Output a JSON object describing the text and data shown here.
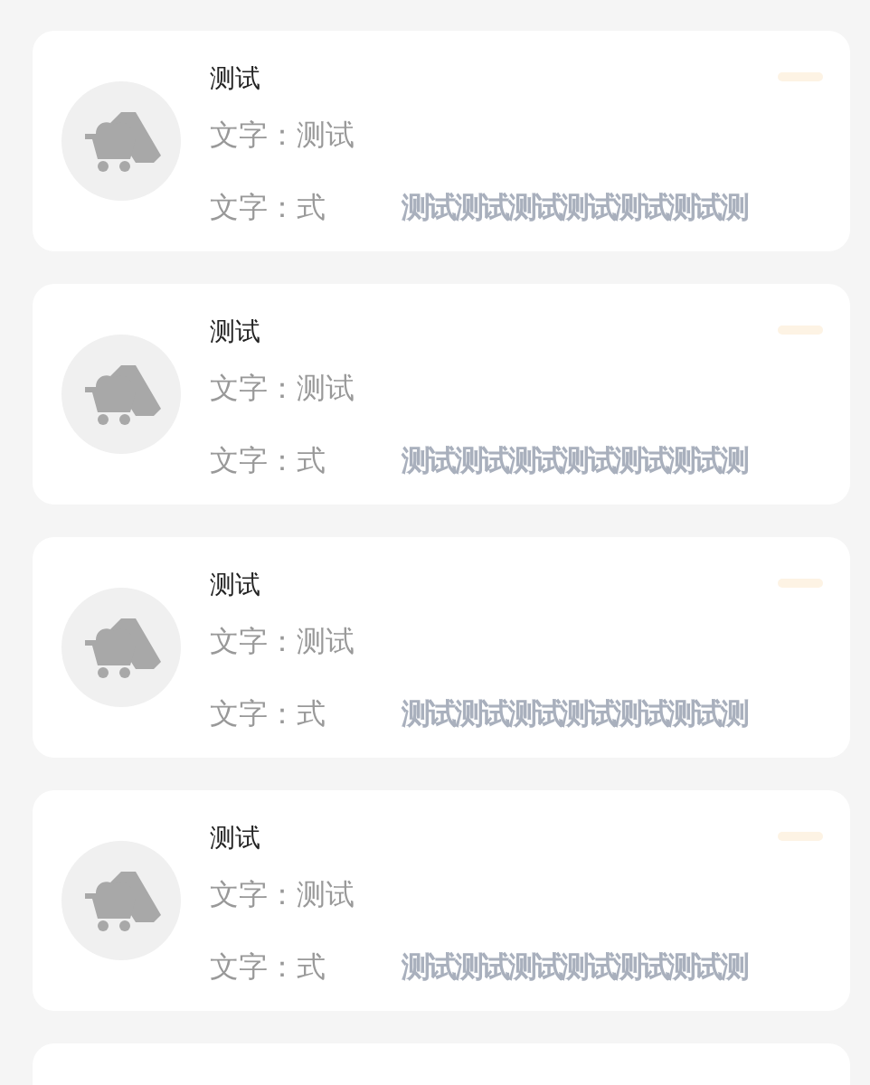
{
  "cards": [
    {
      "title": "测试",
      "line_1": "文字：测试",
      "line_2": "文字：式",
      "line_2_extra": "测试测试测试测试测试测试测"
    },
    {
      "title": "测试",
      "line_1": "文字：测试",
      "line_2": "文字：式",
      "line_2_extra": "测试测试测试测试测试测试测"
    },
    {
      "title": "测试",
      "line_1": "文字：测试",
      "line_2": "文字：式",
      "line_2_extra": "测试测试测试测试测试测试测"
    },
    {
      "title": "测试",
      "line_1": "文字：测试",
      "line_2": "文字：式",
      "line_2_extra": "测试测试测试测试测试测试测"
    }
  ]
}
